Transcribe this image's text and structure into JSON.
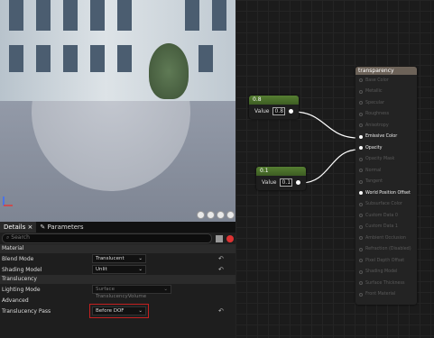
{
  "details_tabs": [
    {
      "label": "Details"
    },
    {
      "label": "Parameters"
    }
  ],
  "search": {
    "placeholder": "Search"
  },
  "categories": {
    "material": "Material",
    "translucency": "Translucency"
  },
  "properties": {
    "blend_mode": {
      "label": "Blend Mode",
      "value": "Translucent"
    },
    "shading_model": {
      "label": "Shading Model",
      "value": "Unlit"
    },
    "lighting_mode": {
      "label": "Lighting Mode",
      "value": "Surface TranslucencyVolume"
    },
    "advanced": {
      "label": "Advanced"
    },
    "translucency_pass": {
      "label": "Translucency Pass",
      "value": "Before DOF"
    }
  },
  "graph": {
    "node1": {
      "title": "0.8",
      "value_label": "Value",
      "value": "0.8"
    },
    "node2": {
      "title": "0.1",
      "value_label": "Value",
      "value": "0.1"
    },
    "material_node": {
      "title": "transparency",
      "inputs": [
        {
          "label": "Base Color",
          "active": false
        },
        {
          "label": "Metallic",
          "active": false
        },
        {
          "label": "Specular",
          "active": false
        },
        {
          "label": "Roughness",
          "active": false
        },
        {
          "label": "Anisotropy",
          "active": false
        },
        {
          "label": "Emissive Color",
          "active": true
        },
        {
          "label": "Opacity",
          "active": true
        },
        {
          "label": "Opacity Mask",
          "active": false
        },
        {
          "label": "Normal",
          "active": false
        },
        {
          "label": "Tangent",
          "active": false
        },
        {
          "label": "World Position Offset",
          "active": true
        },
        {
          "label": "Subsurface Color",
          "active": false
        },
        {
          "label": "Custom Data 0",
          "active": false
        },
        {
          "label": "Custom Data 1",
          "active": false
        },
        {
          "label": "Ambient Occlusion",
          "active": false
        },
        {
          "label": "Refraction (Disabled)",
          "active": false
        },
        {
          "label": "Pixel Depth Offset",
          "active": false
        },
        {
          "label": "Shading Model",
          "active": false
        },
        {
          "label": "Surface Thickness",
          "active": false
        },
        {
          "label": "Front Material",
          "active": false
        }
      ]
    }
  },
  "icons": {
    "reset": "reset-arrow-icon",
    "dropdown": "chevron-down-icon"
  }
}
